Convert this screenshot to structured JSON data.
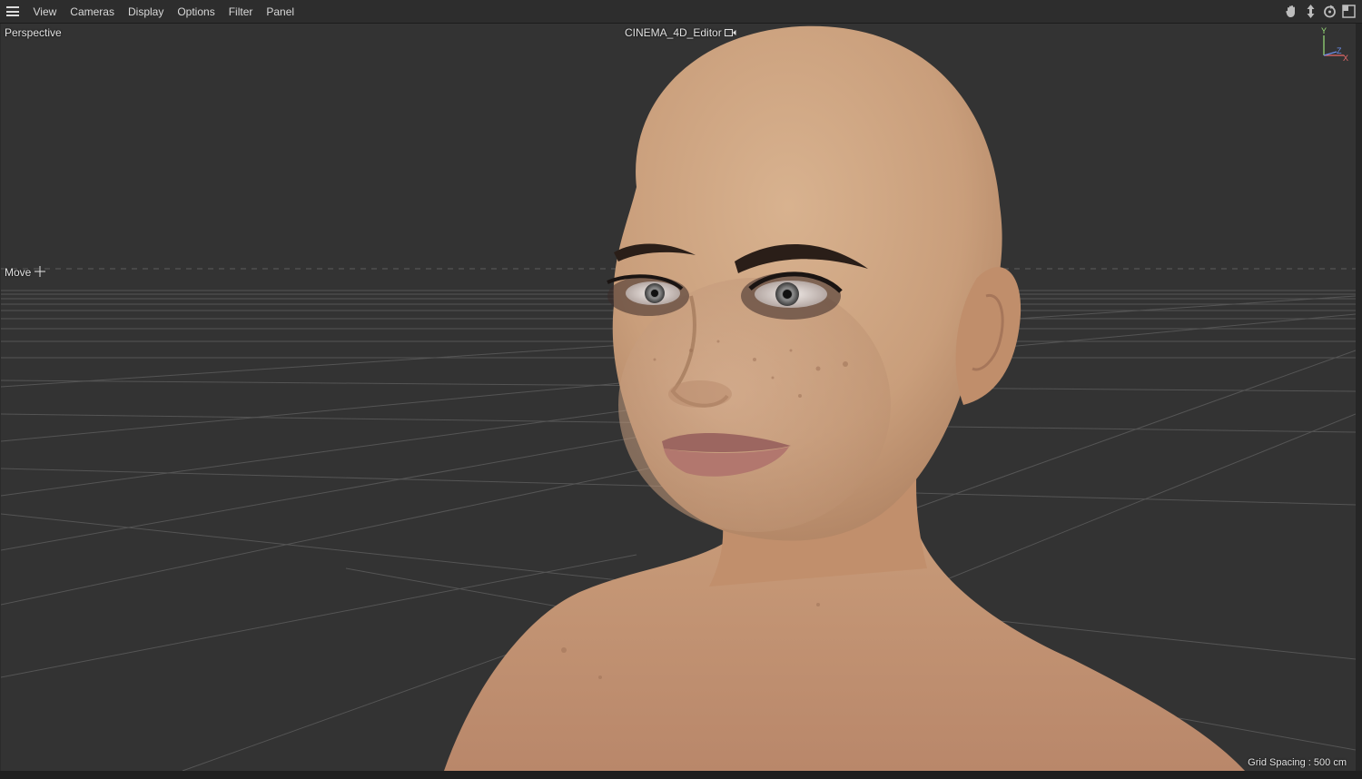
{
  "menubar": {
    "items": [
      "View",
      "Cameras",
      "Display",
      "Options",
      "Filter",
      "Panel"
    ],
    "nav_icons": [
      "pan-hand-icon",
      "dolly-move-icon",
      "rotate-orbit-icon",
      "maximize-view-icon"
    ]
  },
  "viewport": {
    "camera_label": "Perspective",
    "active_camera": "CINEMA_4D_Editor",
    "tool_label": "Move",
    "grid_spacing": "Grid Spacing : 500 cm",
    "axis_labels": {
      "y": "Y",
      "z": "Z",
      "x": "X"
    }
  },
  "colors": {
    "background": "#333333",
    "menubar": "#2d2d2d",
    "grid": "#5a5a5a",
    "skin": "#c79a78",
    "axis_y": "#9be37a",
    "axis_x": "#e86a6a",
    "axis_z": "#6a8de8"
  }
}
